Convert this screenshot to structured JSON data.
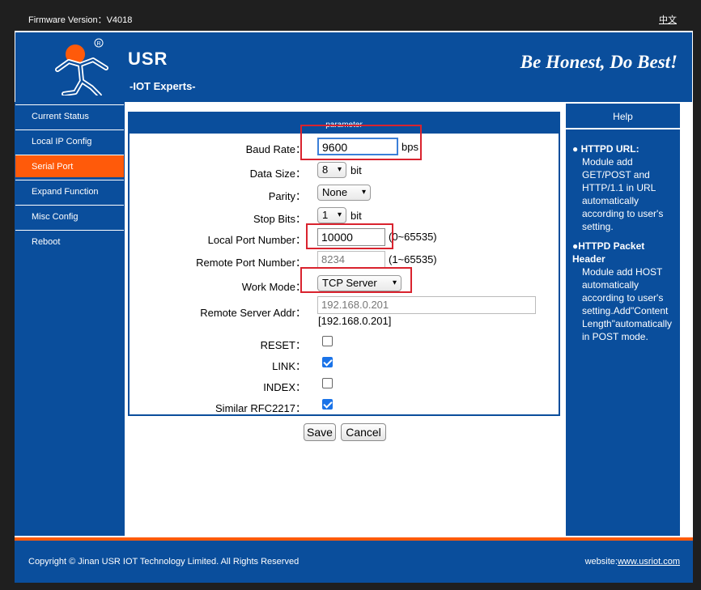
{
  "topbar": {
    "firmware": "Firmware Version：V4018",
    "lang": "中文"
  },
  "header": {
    "brand": "USR",
    "sub": "-IOT Experts-",
    "slogan": "Be Honest, Do Best!"
  },
  "sidebar": {
    "items": [
      {
        "label": "Current Status"
      },
      {
        "label": "Local IP Config"
      },
      {
        "label": "Serial Port"
      },
      {
        "label": "Expand Function"
      },
      {
        "label": "Misc Config"
      },
      {
        "label": "Reboot"
      }
    ],
    "active_index": 2
  },
  "form": {
    "section_title": "parameter",
    "baud_rate": {
      "label": "Baud Rate：",
      "value": "9600",
      "unit": "bps"
    },
    "data_size": {
      "label": "Data Size：",
      "value": "8",
      "unit": "bit"
    },
    "parity": {
      "label": "Parity：",
      "value": "None"
    },
    "stop_bits": {
      "label": "Stop Bits：",
      "value": "1",
      "unit": "bit"
    },
    "local_port": {
      "label": "Local Port Number：",
      "value": "10000",
      "range": "(0~65535)"
    },
    "remote_port": {
      "label": "Remote Port Number：",
      "value": "8234",
      "range": "(1~65535)"
    },
    "work_mode": {
      "label": "Work Mode：",
      "value": "TCP Server"
    },
    "remote_addr": {
      "label": "Remote Server Addr：",
      "value": "192.168.0.201",
      "note": "[192.168.0.201]"
    },
    "reset": {
      "label": "RESET：",
      "checked": false
    },
    "link": {
      "label": "LINK：",
      "checked": true
    },
    "index": {
      "label": "INDEX：",
      "checked": false
    },
    "rfc2217": {
      "label": "Similar RFC2217：",
      "checked": true
    }
  },
  "buttons": {
    "save": "Save",
    "cancel": "Cancel"
  },
  "help": {
    "title": "Help",
    "items": [
      {
        "title": "● HTTPD URL:",
        "text": "Module add GET/POST and HTTP/1.1 in URL automatically according to user's setting."
      },
      {
        "title": "●HTTPD Packet Header",
        "text": "Module add HOST automatically according to user's setting.Add\"Content Length\"automatically in POST mode."
      }
    ]
  },
  "footer": {
    "copyright": "Copyright © Jinan USR IOT Technology Limited. All Rights Reserved",
    "site_label": "website:",
    "site_link": "www.usriot.com"
  },
  "colors": {
    "brand_blue": "#0a4e9c",
    "accent_orange": "#ff5a0a",
    "annotation_red": "#d9232e"
  }
}
